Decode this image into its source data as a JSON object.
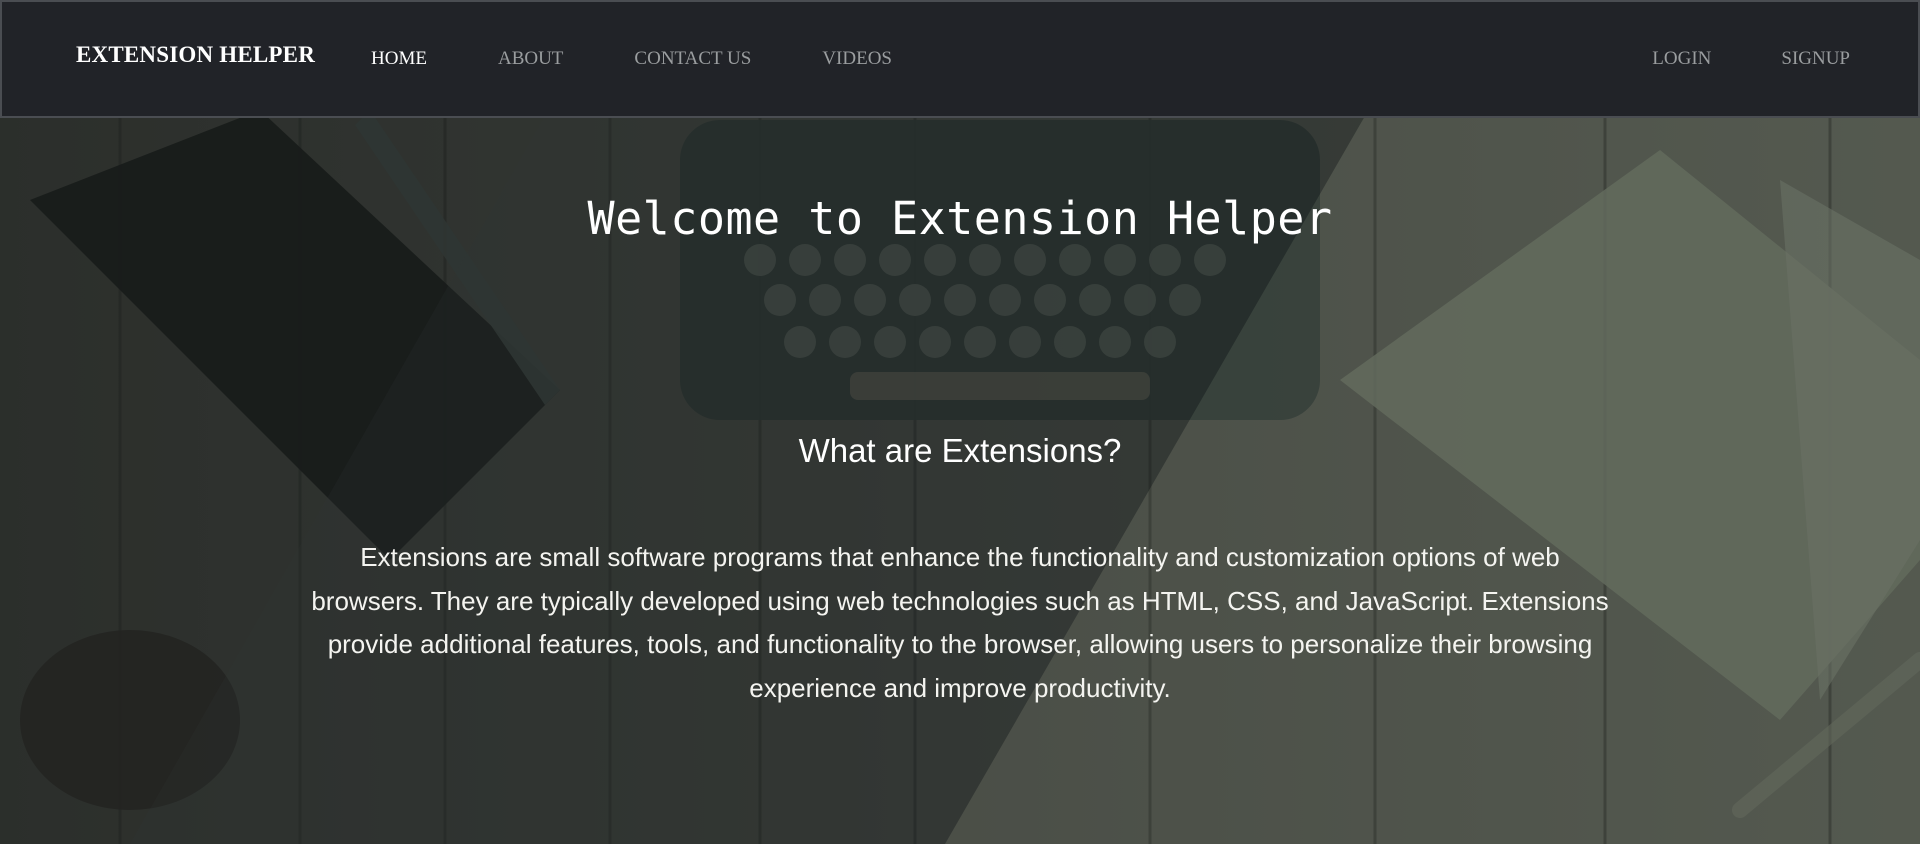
{
  "navbar": {
    "brand": "EXTENSION HELPER",
    "left_links": [
      {
        "label": "HOME",
        "active": true
      },
      {
        "label": "ABOUT",
        "active": false
      },
      {
        "label": "CONTACT US",
        "active": false
      },
      {
        "label": "VIDEOS",
        "active": false
      }
    ],
    "right_links": [
      {
        "label": "LOGIN"
      },
      {
        "label": "SIGNUP"
      }
    ]
  },
  "hero": {
    "title": "Welcome to Extension Helper",
    "subtitle": "What are Extensions?",
    "body": "Extensions are small software programs that enhance the functionality and customization options of web browsers. They are typically developed using web technologies such as HTML, CSS, and JavaScript. Extensions provide additional features, tools, and functionality to the browser, allowing users to personalize their browsing experience and improve productivity."
  },
  "colors": {
    "navbar_bg": "#212328",
    "active_link": "#ffffff",
    "inactive_link": "#9a9d9f",
    "hero_text": "#ffffff"
  }
}
